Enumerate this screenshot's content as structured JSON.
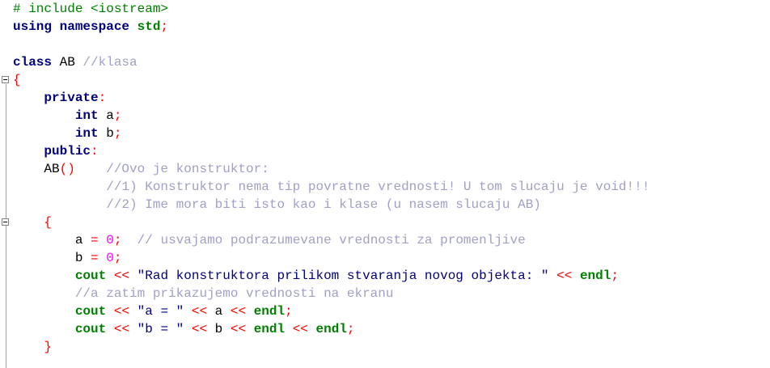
{
  "editor": {
    "lines": [
      {
        "id": "include",
        "tokens": [
          {
            "t": "# include <iostream>",
            "c": "pre"
          }
        ]
      },
      {
        "id": "using",
        "tokens": [
          {
            "t": "using namespace",
            "c": "kw"
          },
          {
            "t": " ",
            "c": "id"
          },
          {
            "t": "std",
            "c": "green"
          },
          {
            "t": ";",
            "c": "op"
          }
        ]
      },
      {
        "id": "blank1",
        "tokens": []
      },
      {
        "id": "class",
        "tokens": [
          {
            "t": "class",
            "c": "kw"
          },
          {
            "t": " AB ",
            "c": "id"
          },
          {
            "t": "//klasa",
            "c": "cm"
          }
        ]
      },
      {
        "id": "open-brace",
        "tokens": [
          {
            "t": "{",
            "c": "op"
          }
        ]
      },
      {
        "id": "private",
        "tokens": [
          {
            "t": "    ",
            "c": "id"
          },
          {
            "t": "private",
            "c": "kw"
          },
          {
            "t": ":",
            "c": "op"
          }
        ]
      },
      {
        "id": "int-a",
        "tokens": [
          {
            "t": "        ",
            "c": "id"
          },
          {
            "t": "int",
            "c": "kw"
          },
          {
            "t": " a",
            "c": "id"
          },
          {
            "t": ";",
            "c": "op"
          }
        ]
      },
      {
        "id": "int-b",
        "tokens": [
          {
            "t": "        ",
            "c": "id"
          },
          {
            "t": "int",
            "c": "kw"
          },
          {
            "t": " b",
            "c": "id"
          },
          {
            "t": ";",
            "c": "op"
          }
        ]
      },
      {
        "id": "public",
        "tokens": [
          {
            "t": "    ",
            "c": "id"
          },
          {
            "t": "public",
            "c": "kw"
          },
          {
            "t": ":",
            "c": "op"
          }
        ]
      },
      {
        "id": "ctor",
        "tokens": [
          {
            "t": "    AB",
            "c": "id"
          },
          {
            "t": "()",
            "c": "op"
          },
          {
            "t": "    ",
            "c": "id"
          },
          {
            "t": "//Ovo je konstruktor:",
            "c": "cm"
          }
        ]
      },
      {
        "id": "comment1",
        "tokens": [
          {
            "t": "            ",
            "c": "id"
          },
          {
            "t": "//1) Konstruktor nema tip povratne vrednosti! U tom slucaju je void!!!",
            "c": "cm"
          }
        ]
      },
      {
        "id": "comment2",
        "tokens": [
          {
            "t": "            ",
            "c": "id"
          },
          {
            "t": "//2) Ime mora biti isto kao i klase (u nasem slucaju AB)",
            "c": "cm"
          }
        ]
      },
      {
        "id": "ctor-open",
        "tokens": [
          {
            "t": "    ",
            "c": "id"
          },
          {
            "t": "{",
            "c": "op"
          }
        ]
      },
      {
        "id": "assign-a",
        "tokens": [
          {
            "t": "        a ",
            "c": "id"
          },
          {
            "t": "=",
            "c": "op"
          },
          {
            "t": " ",
            "c": "id"
          },
          {
            "t": "0",
            "c": "num"
          },
          {
            "t": ";",
            "c": "op"
          },
          {
            "t": "  ",
            "c": "id"
          },
          {
            "t": "// usvajamo podrazumevane vrednosti za promenljive",
            "c": "cm"
          }
        ]
      },
      {
        "id": "assign-b",
        "tokens": [
          {
            "t": "        b ",
            "c": "id"
          },
          {
            "t": "=",
            "c": "op"
          },
          {
            "t": " ",
            "c": "id"
          },
          {
            "t": "0",
            "c": "num"
          },
          {
            "t": ";",
            "c": "op"
          }
        ]
      },
      {
        "id": "cout1",
        "tokens": [
          {
            "t": "        ",
            "c": "id"
          },
          {
            "t": "cout",
            "c": "green"
          },
          {
            "t": " ",
            "c": "id"
          },
          {
            "t": "<<",
            "c": "op"
          },
          {
            "t": " ",
            "c": "id"
          },
          {
            "t": "\"Rad konstruktora prilikom stvaranja novog objekta: \"",
            "c": "str"
          },
          {
            "t": " ",
            "c": "id"
          },
          {
            "t": "<<",
            "c": "op"
          },
          {
            "t": " ",
            "c": "id"
          },
          {
            "t": "endl",
            "c": "green"
          },
          {
            "t": ";",
            "c": "op"
          }
        ]
      },
      {
        "id": "comment3",
        "tokens": [
          {
            "t": "        ",
            "c": "id"
          },
          {
            "t": "//a zatim prikazujemo vrednosti na ekranu",
            "c": "cm"
          }
        ]
      },
      {
        "id": "cout2",
        "tokens": [
          {
            "t": "        ",
            "c": "id"
          },
          {
            "t": "cout",
            "c": "green"
          },
          {
            "t": " ",
            "c": "id"
          },
          {
            "t": "<<",
            "c": "op"
          },
          {
            "t": " ",
            "c": "id"
          },
          {
            "t": "\"a = \"",
            "c": "str"
          },
          {
            "t": " ",
            "c": "id"
          },
          {
            "t": "<<",
            "c": "op"
          },
          {
            "t": " a ",
            "c": "id"
          },
          {
            "t": "<<",
            "c": "op"
          },
          {
            "t": " ",
            "c": "id"
          },
          {
            "t": "endl",
            "c": "green"
          },
          {
            "t": ";",
            "c": "op"
          }
        ]
      },
      {
        "id": "cout3",
        "tokens": [
          {
            "t": "        ",
            "c": "id"
          },
          {
            "t": "cout",
            "c": "green"
          },
          {
            "t": " ",
            "c": "id"
          },
          {
            "t": "<<",
            "c": "op"
          },
          {
            "t": " ",
            "c": "id"
          },
          {
            "t": "\"b = \"",
            "c": "str"
          },
          {
            "t": " ",
            "c": "id"
          },
          {
            "t": "<<",
            "c": "op"
          },
          {
            "t": " b ",
            "c": "id"
          },
          {
            "t": "<<",
            "c": "op"
          },
          {
            "t": " ",
            "c": "id"
          },
          {
            "t": "endl",
            "c": "green"
          },
          {
            "t": " ",
            "c": "id"
          },
          {
            "t": "<<",
            "c": "op"
          },
          {
            "t": " ",
            "c": "id"
          },
          {
            "t": "endl",
            "c": "green"
          },
          {
            "t": ";",
            "c": "op"
          }
        ]
      },
      {
        "id": "ctor-close",
        "tokens": [
          {
            "t": "    ",
            "c": "id"
          },
          {
            "t": "}",
            "c": "op"
          }
        ]
      }
    ],
    "fold_markers": [
      "open-brace",
      "ctor-open"
    ]
  },
  "colors": {
    "keyword": "#000080",
    "type_green": "#008000",
    "operator": "#ff0000",
    "number": "#ff00ff",
    "string": "#000080",
    "comment": "#a0a0c8",
    "background": "#ffffff"
  }
}
